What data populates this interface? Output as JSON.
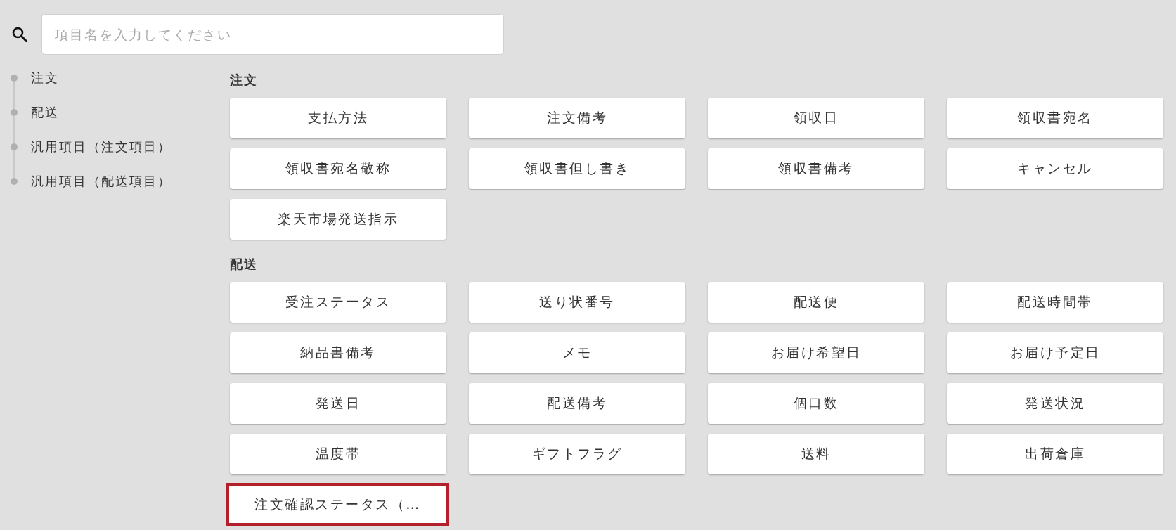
{
  "search": {
    "placeholder": "項目名を入力してください"
  },
  "sidebar": {
    "items": [
      {
        "label": "注文"
      },
      {
        "label": "配送"
      },
      {
        "label": "汎用項目（注文項目）"
      },
      {
        "label": "汎用項目（配送項目）"
      }
    ]
  },
  "sections": [
    {
      "title": "注文",
      "buttons": [
        {
          "label": "支払方法",
          "highlighted": false
        },
        {
          "label": "注文備考",
          "highlighted": false
        },
        {
          "label": "領収日",
          "highlighted": false
        },
        {
          "label": "領収書宛名",
          "highlighted": false
        },
        {
          "label": "領収書宛名敬称",
          "highlighted": false
        },
        {
          "label": "領収書但し書き",
          "highlighted": false
        },
        {
          "label": "領収書備考",
          "highlighted": false
        },
        {
          "label": "キャンセル",
          "highlighted": false
        },
        {
          "label": "楽天市場発送指示",
          "highlighted": false
        }
      ]
    },
    {
      "title": "配送",
      "buttons": [
        {
          "label": "受注ステータス",
          "highlighted": false
        },
        {
          "label": "送り状番号",
          "highlighted": false
        },
        {
          "label": "配送便",
          "highlighted": false
        },
        {
          "label": "配送時間帯",
          "highlighted": false
        },
        {
          "label": "納品書備考",
          "highlighted": false
        },
        {
          "label": "メモ",
          "highlighted": false
        },
        {
          "label": "お届け希望日",
          "highlighted": false
        },
        {
          "label": "お届け予定日",
          "highlighted": false
        },
        {
          "label": "発送日",
          "highlighted": false
        },
        {
          "label": "配送備考",
          "highlighted": false
        },
        {
          "label": "個口数",
          "highlighted": false
        },
        {
          "label": "発送状況",
          "highlighted": false
        },
        {
          "label": "温度帯",
          "highlighted": false
        },
        {
          "label": "ギフトフラグ",
          "highlighted": false
        },
        {
          "label": "送料",
          "highlighted": false
        },
        {
          "label": "出荷倉庫",
          "highlighted": false
        },
        {
          "label": "注文確認ステータス（…",
          "highlighted": true
        }
      ]
    }
  ]
}
